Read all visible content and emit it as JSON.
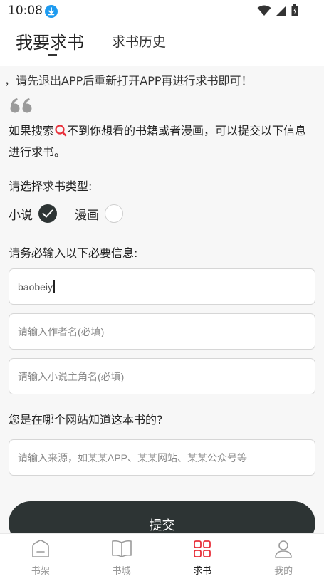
{
  "status_bar": {
    "time": "10:08"
  },
  "header": {
    "active_tab": "我要求书",
    "other_tab": "求书历史"
  },
  "notice": "，请先退出APP后重新打开APP再进行求书即可！",
  "intro": {
    "part1": "如果搜索",
    "part2": "不到你想看的书籍或者漫画，可以提交以下信息进行求书。"
  },
  "type_section": {
    "label": "请选择求书类型:",
    "options": [
      {
        "label": "小说",
        "checked": true
      },
      {
        "label": "漫画",
        "checked": false
      }
    ]
  },
  "required_section": {
    "label": "请务必输入以下必要信息:"
  },
  "fields": {
    "book_name_value": "baobeiy",
    "author_placeholder": "请输入作者名(必填)",
    "protagonist_placeholder": "请输入小说主角名(必填)"
  },
  "source_section": {
    "label": "您是在哪个网站知道这本书的?",
    "placeholder": "请输入来源，如某某APP、某某网站、某某公众号等"
  },
  "submit_label": "提交",
  "bottom_nav": [
    {
      "label": "书架",
      "icon": "bookshelf-icon",
      "active": false
    },
    {
      "label": "书城",
      "icon": "book-icon",
      "active": false
    },
    {
      "label": "求书",
      "icon": "grid-icon",
      "active": true
    },
    {
      "label": "我的",
      "icon": "user-icon",
      "active": false
    }
  ],
  "colors": {
    "accent": "#e8303a",
    "dark": "#2d3434",
    "download_badge": "#1e9bf0"
  }
}
